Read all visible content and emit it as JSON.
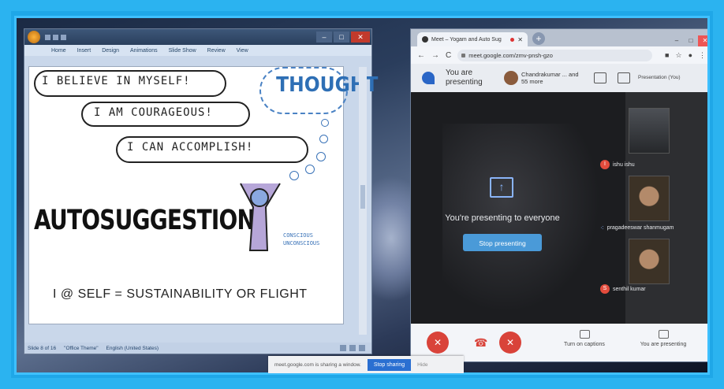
{
  "ppt": {
    "ribbon": [
      "Home",
      "Insert",
      "Design",
      "Animations",
      "Slide Show",
      "Review",
      "View"
    ],
    "status": {
      "slide": "Slide 8 of 16",
      "theme": "\"Office Theme\"",
      "lang": "English (United States)"
    }
  },
  "slide": {
    "line1": "I BELIEVE IN MYSELF!",
    "line2": "I AM COURAGEOUS!",
    "line3": "I CAN ACCOMPLISH!",
    "thought": "THOUGHT",
    "auto": "AUTOSUGGESTION",
    "conscious1": "CONSCIOUS",
    "conscious2": "UNCONSCIOUS",
    "formula": "I @ SELF = SUSTAINABILITY OR FLIGHT"
  },
  "chrome": {
    "tab_title": "Meet – Yogam and Auto Sug",
    "url": "meet.google.com/zmv-pnsh-gzo"
  },
  "meet": {
    "you_presenting": "You are presenting",
    "people": "Chandrakumar ... and 55 more",
    "presentation_label": "Presentation (You)",
    "presenting_msg": "You're presenting to everyone",
    "stop_presenting": "Stop presenting",
    "participants": [
      {
        "initial": "I",
        "name": "ishu ishu"
      },
      {
        "initial": "",
        "name": "pragadeeswar shanmugam"
      },
      {
        "initial": "S",
        "name": "senthil kumar"
      }
    ],
    "captions": "Turn on captions",
    "you_are_presenting": "You are presenting"
  },
  "share_bar": {
    "message": "meet.google.com is sharing a window.",
    "stop": "Stop sharing",
    "hide": "Hide"
  },
  "colors": {
    "frame": "#2bb3f0",
    "meet_blue": "#4a9ad8",
    "red": "#d9433a"
  }
}
